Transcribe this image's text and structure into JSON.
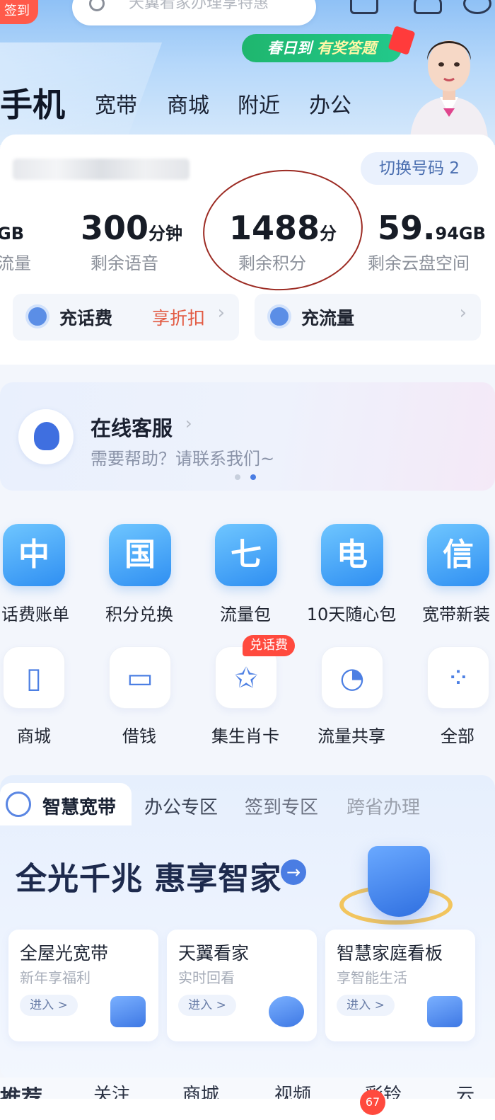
{
  "header": {
    "checkin_label": "签到",
    "search_placeholder": "天翼看家办理享特惠",
    "banner_part1": "春日到",
    "banner_part2": "有奖答题",
    "main_tab": "手机",
    "tabs": [
      "宽带",
      "商城",
      "附近",
      "办公"
    ]
  },
  "account": {
    "switch_label": "切换号码 2",
    "stats": [
      {
        "value": "GB",
        "unit": "",
        "label": "流量"
      },
      {
        "value": "300",
        "unit": "分钟",
        "label": "剩余语音"
      },
      {
        "value": "1488",
        "unit": "分",
        "label": "剩余积分"
      },
      {
        "value": "59.",
        "unit": "94GB",
        "label": "剩余云盘空间"
      }
    ],
    "topup": [
      {
        "label": "充话费",
        "promo": "享折扣"
      },
      {
        "label": "充流量",
        "promo": ""
      }
    ]
  },
  "service": {
    "title": "在线客服",
    "subtitle": "需要帮助？请联系我们~"
  },
  "grid": {
    "row1": [
      {
        "glyph": "中",
        "label": "话费账单"
      },
      {
        "glyph": "国",
        "label": "积分兑换"
      },
      {
        "glyph": "七",
        "label": "流量包"
      },
      {
        "glyph": "电",
        "label": "10天随心包"
      },
      {
        "glyph": "信",
        "label": "宽带新装"
      }
    ],
    "row2": [
      {
        "icon": "phone-icon",
        "label": "商城"
      },
      {
        "icon": "wallet-icon",
        "label": "借钱"
      },
      {
        "icon": "card-icon",
        "label": "集生肖卡"
      },
      {
        "icon": "share-icon",
        "label": "流量共享"
      },
      {
        "icon": "grid-icon",
        "label": "全部"
      }
    ],
    "badge": "兑话费"
  },
  "broadband": {
    "tabs": [
      "智慧宽带",
      "办公专区",
      "签到专区",
      "跨省办理"
    ],
    "headline": "全光千兆 惠享智家",
    "cards": [
      {
        "title": "全屋光宽带",
        "sub": "新年享福利",
        "cta": "进入 >"
      },
      {
        "title": "天翼看家",
        "sub": "实时回看",
        "cta": "进入 >"
      },
      {
        "title": "智慧家庭看板",
        "sub": "享智能生活",
        "cta": "进入 >"
      }
    ]
  },
  "bottom": {
    "tabs": [
      "推荐",
      "关注",
      "商城",
      "视频",
      "彩铃",
      "云"
    ],
    "badge_count": "67"
  },
  "colors": {
    "accent_blue": "#2f8ff2",
    "promo_red": "#e25a42",
    "badge_red": "#ff4a3e",
    "annotation_circle": "#9c2b23"
  }
}
